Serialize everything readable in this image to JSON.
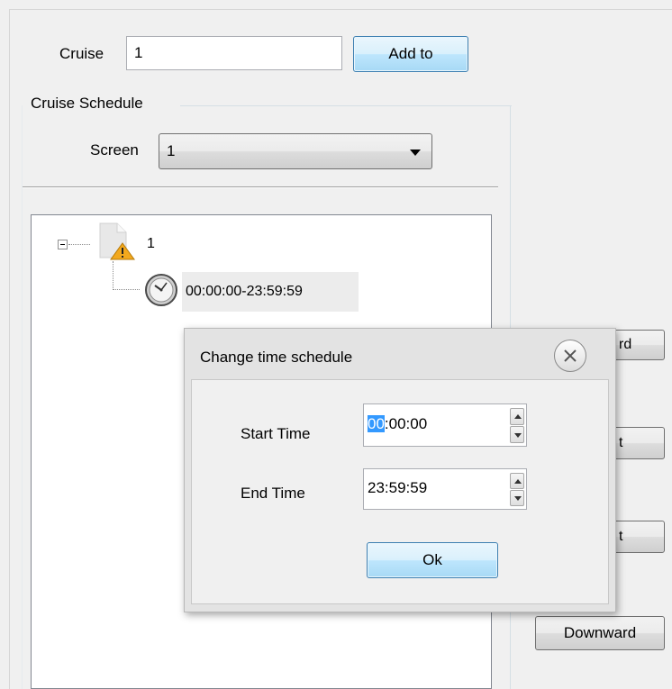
{
  "cruise": {
    "label": "Cruise",
    "value": "1",
    "add_button": "Add to"
  },
  "schedule": {
    "group_label": "Cruise Schedule",
    "screen_label": "Screen",
    "screen_value": "1",
    "tree": {
      "root_label": "1",
      "child_label": "00:00:00-23:59:59"
    }
  },
  "side_buttons": {
    "upward_partial": "rd",
    "second_partial": "t",
    "third_partial": "t",
    "downward": "Downward"
  },
  "dialog": {
    "title": "Change time schedule",
    "start_label": "Start Time",
    "start_value_selected": "00",
    "start_value_rest": ":00:00",
    "end_label": "End Time",
    "end_value": "23:59:59",
    "ok_button": "Ok"
  },
  "icons": {
    "expand": "minus-box-icon",
    "camera": "warning-document-icon",
    "clock": "clock-icon",
    "close": "close-icon",
    "combo_arrow": "chevron-down-icon",
    "spin_up": "triangle-up-icon",
    "spin_down": "triangle-down-icon"
  }
}
